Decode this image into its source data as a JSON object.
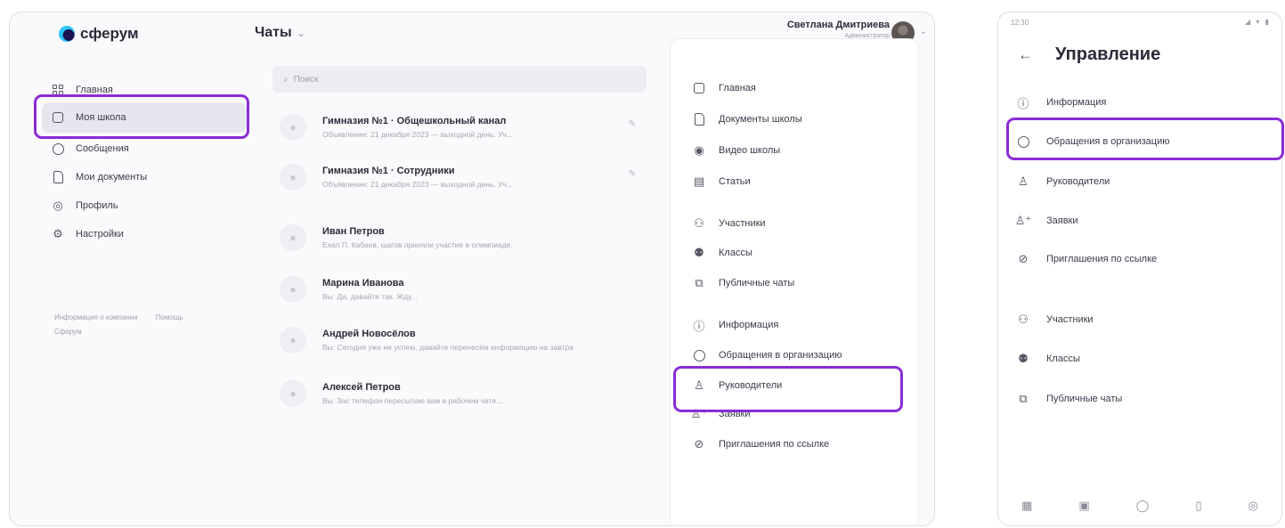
{
  "desktop": {
    "logo_text": "сферум",
    "chats_title": "Чаты",
    "user_name": "Светлана Дмитриева",
    "user_sub": "Администратор",
    "sidebar": [
      {
        "label": "Главная",
        "icon": "grid-icon"
      },
      {
        "label": "Моя школа",
        "icon": "school-icon"
      },
      {
        "label": "Сообщения",
        "icon": "chat-icon"
      },
      {
        "label": "Мои документы",
        "icon": "document-icon"
      },
      {
        "label": "Профиль",
        "icon": "profile-icon"
      },
      {
        "label": "Настройки",
        "icon": "gear-icon"
      }
    ],
    "sidebar_links": [
      "Информация о компании",
      "Помощь",
      "Сферум"
    ],
    "search_placeholder": "Поиск",
    "chats": [
      {
        "title": "Гимназия №1 · Общешкольный канал",
        "preview": "Объявление: 21 декабря 2023 — выходной день. Уч..."
      },
      {
        "title": "Гимназия №1 · Сотрудники",
        "preview": "Объявление: 21 декабря 2023 — выходной день. Уч..."
      },
      {
        "title": "Иван Петров",
        "preview": "Ехал П. Кабаев, шагов приняли участие в олимпиаде."
      },
      {
        "title": "Марина Иванова",
        "preview": "Вы: Да, давайте так. Жду..."
      },
      {
        "title": "Андрей Новосёлов",
        "preview": "Вы: Сегодня уже не успею, давайте перенесём информацию на завтра"
      },
      {
        "title": "Алексей Петров",
        "preview": "Вы: Зас телефон пересылаю вам в рабочем чате..."
      }
    ],
    "right_panel": [
      {
        "label": "Главная",
        "icon": "home-icon"
      },
      {
        "label": "Документы школы",
        "icon": "document-icon"
      },
      {
        "label": "Видео школы",
        "icon": "video-icon"
      },
      {
        "label": "Статьи",
        "icon": "article-icon"
      },
      {
        "label": "Участники",
        "icon": "members-icon"
      },
      {
        "label": "Классы",
        "icon": "classes-icon"
      },
      {
        "label": "Публичные чаты",
        "icon": "public-chats-icon"
      },
      {
        "label": "Информация",
        "icon": "info-icon"
      },
      {
        "label": "Обращения в организацию",
        "icon": "chat-icon"
      },
      {
        "label": "Руководители",
        "icon": "person-icon"
      },
      {
        "label": "Заявки",
        "icon": "person-add-icon"
      },
      {
        "label": "Приглашения по ссылке",
        "icon": "link-icon"
      }
    ]
  },
  "mobile": {
    "status_time": "12:30",
    "title": "Управление",
    "items": [
      {
        "label": "Информация",
        "icon": "info-icon"
      },
      {
        "label": "Обращения в организацию",
        "icon": "chat-icon"
      },
      {
        "label": "Руководители",
        "icon": "person-icon"
      },
      {
        "label": "Заявки",
        "icon": "person-add-icon"
      },
      {
        "label": "Приглашения по ссылке",
        "icon": "link-icon"
      },
      {
        "label": "Участники",
        "icon": "members-icon"
      },
      {
        "label": "Классы",
        "icon": "classes-icon"
      },
      {
        "label": "Публичные чаты",
        "icon": "public-chats-icon"
      }
    ]
  },
  "colors": {
    "highlight": "#8a2bd6",
    "logo_blue": "#2ec4ff",
    "logo_dark": "#1a1450"
  }
}
